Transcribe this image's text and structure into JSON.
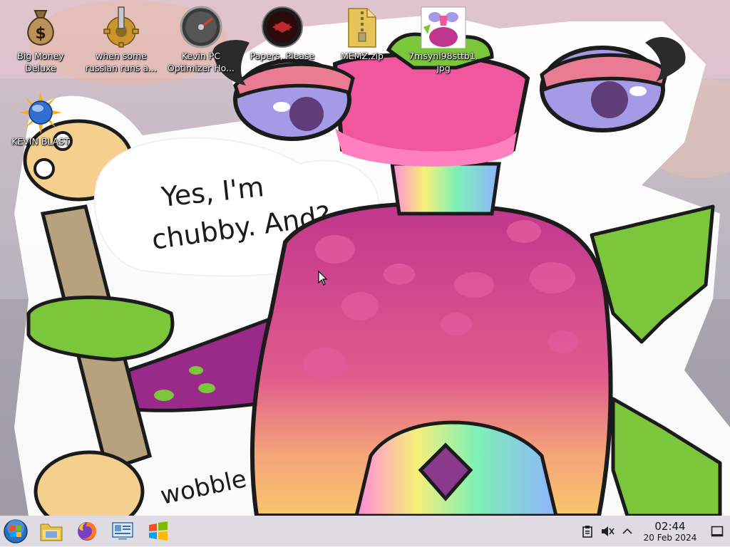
{
  "wallpaper": {
    "speech_line1": "Yes, I'm",
    "speech_line2": "chubby. And?",
    "sound_text": "wobble",
    "colors": {
      "body": "#c0368d",
      "spots": "#e25a9c",
      "green": "#7cc63b",
      "eye": "#a59ae6",
      "bubble": "#ffffff"
    }
  },
  "desktop": {
    "icons": [
      {
        "label_line1": "Big Money",
        "label_line2": "Deluxe",
        "icon": "money-bag-icon"
      },
      {
        "label_line1": "when some",
        "label_line2": "russian runs a...",
        "icon": "gear-icon"
      },
      {
        "label_line1": "Kevin PC",
        "label_line2": "Optimizer Ho...",
        "icon": "speedometer-icon"
      },
      {
        "label_line1": "Papers, Please",
        "label_line2": "",
        "icon": "papers-please-icon"
      },
      {
        "label_line1": "MEMZ.zip",
        "label_line2": "",
        "icon": "zip-folder-icon"
      },
      {
        "label_line1": "7msynl98sttb1.",
        "label_line2": "jpg",
        "icon": "image-thumbnail-icon"
      },
      {
        "label_line1": "KEVIN BLAST",
        "label_line2": "",
        "icon": "globe-burst-icon"
      }
    ]
  },
  "taskbar": {
    "pinned": [
      "start-orb-icon",
      "file-explorer-icon",
      "firefox-icon",
      "control-panel-icon",
      "windows-flag-icon"
    ],
    "tray": [
      "clipboard-icon",
      "volume-muted-icon",
      "chevron-up-icon"
    ],
    "time": "02:44",
    "date": "20 Feb 2024"
  }
}
